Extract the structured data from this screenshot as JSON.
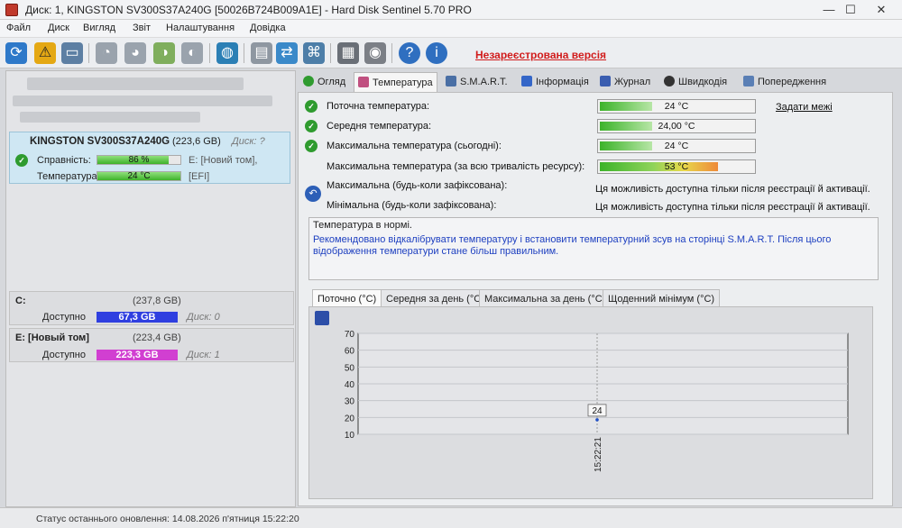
{
  "window": {
    "title": "Диск: 1, KINGSTON SV300S37A240G [50026B724B009A1E]  -  Hard Disk Sentinel 5.70 PRO",
    "minimize": "—",
    "maximize": "☐",
    "close": "✕"
  },
  "menu": [
    "Файл",
    "Диск",
    "Вигляд",
    "Звіт",
    "Налаштування",
    "Довідка"
  ],
  "toolbar": {
    "unregistered_label": "Незареєстрована версія"
  },
  "left": {
    "disk": {
      "name": "KINGSTON SV300S37A240G",
      "size": "(223,6 GB)",
      "disk_label": "Диск: ?",
      "health_label": "Справність:",
      "health_value": "86 %",
      "health_percent": 86,
      "temp_label": "Температура:",
      "temp_value": "24 °C",
      "vol1": "E: [Новий том],",
      "vol2": "[EFI]"
    },
    "volumes": [
      {
        "name": "C:",
        "size": "(237,8 GB)",
        "free_label": "Доступно",
        "free_value": "67,3 GB",
        "disk": "Диск: 0",
        "color": "#2f3fe0"
      },
      {
        "name": "E: [Новый том]",
        "size": "(223,4 GB)",
        "free_label": "Доступно",
        "free_value": "223,3 GB",
        "disk": "Диск: 1",
        "color": "#d13fd1"
      }
    ]
  },
  "status": {
    "text": "Статус останнього оновлення: 14.08.2026 п'ятниця 15:22:20"
  },
  "tabs": [
    {
      "label": "Огляд",
      "color": "#2f9b2f"
    },
    {
      "label": "Температура",
      "color": "#c05080"
    },
    {
      "label": "S.M.A.R.T.",
      "color": "#4a6fa5"
    },
    {
      "label": "Інформація",
      "color": "#3466c8"
    },
    {
      "label": "Журнал",
      "color": "#3a5db0"
    },
    {
      "label": "Швидкодія",
      "color": "#333333"
    },
    {
      "label": "Попередження",
      "color": "#5a7fb5"
    }
  ],
  "temperature": {
    "set_limits": "Задати межі",
    "rows": [
      {
        "label": "Поточна температура:",
        "value": "24 °C",
        "percent": 34,
        "color": "green"
      },
      {
        "label": "Середня температура:",
        "value": "24,00 °C",
        "percent": 34,
        "color": "green"
      },
      {
        "label": "Максимальна температура (сьогодні):",
        "value": "24 °C",
        "percent": 34,
        "color": "green"
      },
      {
        "label": "Максимальна температура (за всю тривалість ресурсу):",
        "value": "53 °C",
        "percent": 76,
        "color": "grad"
      }
    ],
    "locked_rows": [
      {
        "label": "Максимальна (будь-коли зафіксована):",
        "value": "Ця можливість доступна тільки після реєстрації й активації."
      },
      {
        "label": "Мінімальна (будь-коли зафіксована):",
        "value": "Ця можливість доступна тільки після реєстрації й активації."
      }
    ],
    "note_title": "Температура в нормі.",
    "note_body": "Рекомендовано відкалібрувати температуру і встановити температурний зсув на сторінці S.M.A.R.T. Після цього відображення температури стане більш правильним."
  },
  "subtabs": [
    "Поточно (°C)",
    "Середня за день (°C)",
    "Максимальна за день (°C)",
    "Щоденний мінімум (°C)"
  ],
  "chart_data": {
    "type": "line",
    "x": [
      "15:22:21"
    ],
    "series": [
      {
        "values": [
          24
        ]
      }
    ],
    "point_label": "24",
    "ylim": [
      10,
      70
    ],
    "yticks": [
      10,
      20,
      30,
      40,
      50,
      60,
      70
    ],
    "grid": true
  }
}
